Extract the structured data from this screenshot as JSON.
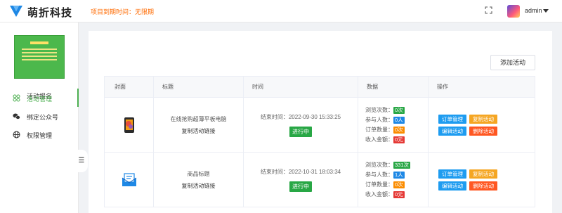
{
  "header": {
    "brand": "萌折科技",
    "expire_text": "项目到期时间：无限期",
    "user_name": "admin",
    "icons": {
      "logo": "brand-logo-icon",
      "fullscreen": "fullscreen-icon",
      "dropdown": "caret-down-icon"
    }
  },
  "sidebar": {
    "activity_title": "活动报名",
    "items": [
      {
        "label": "活动管理",
        "icon": "apps-icon",
        "active": true
      },
      {
        "label": "绑定公众号",
        "icon": "wechat-icon",
        "active": false
      },
      {
        "label": "权限管理",
        "icon": "globe-icon",
        "active": false
      }
    ],
    "toggle": "☰"
  },
  "main": {
    "add_button": "添加活动",
    "columns": [
      "封面",
      "标题",
      "时间",
      "数据",
      "操作"
    ],
    "rows": [
      {
        "cover_icon": "tablet-icon",
        "title": "在线抢购超薄平板电脑",
        "copy_link": "复制活动链接",
        "time": "结束时间：2022-09-30 15:33:25",
        "status": "进行中",
        "stats": [
          {
            "label": "浏览次数：",
            "value": "0次",
            "color": "#28a745"
          },
          {
            "label": "参与人数：",
            "value": "0人",
            "color": "#1e88e5"
          },
          {
            "label": "订单数量：",
            "value": "0次",
            "color": "#fb8c00"
          },
          {
            "label": "收入金额：",
            "value": "0元",
            "color": "#e53935"
          }
        ],
        "ops": [
          "订单管理",
          "复制活动",
          "编辑活动",
          "删除活动"
        ]
      },
      {
        "cover_icon": "message-icon",
        "title": "商品标题",
        "copy_link": "复制活动链接",
        "time": "结束时间：2022-10-31 18:03:34",
        "status": "进行中",
        "stats": [
          {
            "label": "浏览次数：",
            "value": "331次",
            "color": "#28a745"
          },
          {
            "label": "参与人数：",
            "value": "1人",
            "color": "#1e88e5"
          },
          {
            "label": "订单数量：",
            "value": "0次",
            "color": "#fb8c00"
          },
          {
            "label": "收入金额：",
            "value": "0元",
            "color": "#e53935"
          }
        ],
        "ops": [
          "订单管理",
          "复制活动",
          "编辑活动",
          "删除活动"
        ]
      }
    ],
    "op_colors": [
      "#1e9cf0",
      "#f5a623",
      "#1e9cf0",
      "#ff5722"
    ]
  }
}
